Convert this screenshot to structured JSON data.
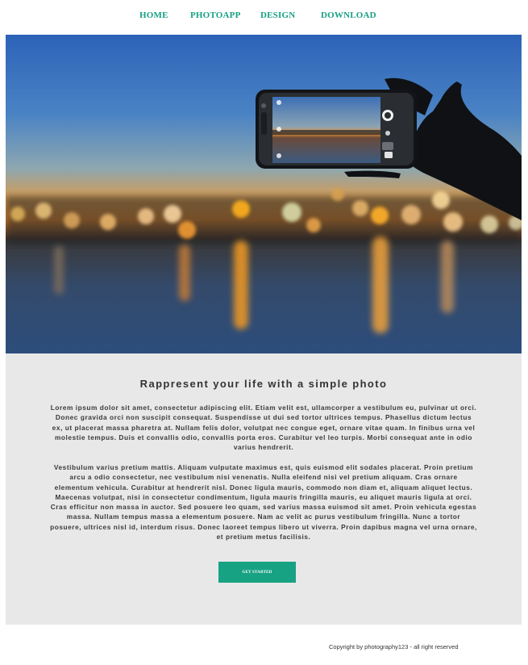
{
  "nav": {
    "items": [
      {
        "label": "HOME"
      },
      {
        "label": "PHOTOAPP"
      },
      {
        "label": "DESIGN"
      },
      {
        "label": "DOWNLOAD"
      }
    ]
  },
  "hero": {
    "image": "hand-holding-phone-sunset-photo"
  },
  "content": {
    "heading": "Rappresent your life with a simple photo",
    "paragraph1": "Lorem ipsum dolor sit amet, consectetur adipiscing elit. Etiam velit est, ullamcorper a vestibulum eu, pulvinar ut orci. Donec gravida orci non suscipit consequat. Suspendisse ut dui sed tortor ultrices tempus. Phasellus dictum lectus ex, ut placerat massa pharetra at. Nullam felis dolor, volutpat nec congue eget, ornare vitae quam. In finibus urna vel molestie tempus. Duis et convallis odio, convallis porta eros. Curabitur vel leo turpis. Morbi consequat ante in odio varius hendrerit.",
    "paragraph2": "Vestibulum varius pretium mattis. Aliquam vulputate maximus est, quis euismod elit sodales placerat. Proin pretium arcu a odio consectetur, nec vestibulum nisi venenatis. Nulla eleifend nisi vel pretium aliquam. Cras ornare elementum vehicula. Curabitur at hendrerit nisl. Donec ligula mauris, commodo non diam et, aliquam aliquet lectus. Maecenas volutpat, nisi in consectetur condimentum, ligula mauris fringilla mauris, eu aliquet mauris ligula at orci. Cras efficitur non massa in auctor. Sed posuere leo quam, sed varius massa euismod sit amet. Proin vehicula egestas massa. Nullam tempus massa a elementum posuere. Nam ac velit ac purus vestibulum fringilla. Nunc a tortor posuere, ultrices nisl id, interdum risus. Donec laoreet tempus libero ut viverra. Proin dapibus magna vel urna ornare, et pretium metus facilisis.",
    "cta_label": "GET STARTED"
  },
  "footer": {
    "copyright": "Copyright by photography123 - all right reserved"
  },
  "colors": {
    "accent": "#16a083",
    "content_bg": "#e8e8e8"
  }
}
